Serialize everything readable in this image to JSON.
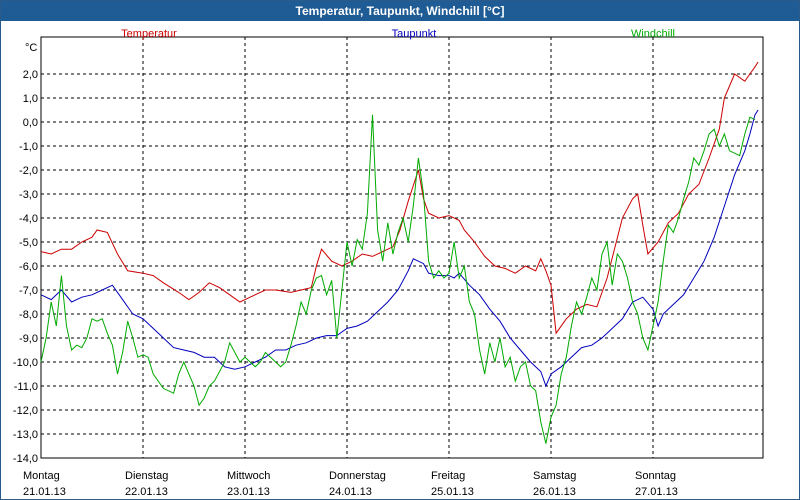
{
  "window": {
    "title": "Temperatur, Taupunkt, Windchill [°C]"
  },
  "chart_data": {
    "type": "line",
    "title": "Temperatur, Taupunkt, Windchill [°C]",
    "ylabel": "°C",
    "ylim": [
      -14,
      3
    ],
    "yticks": [
      "2,0",
      "1,0",
      "0,0",
      "-1,0",
      "-2,0",
      "-3,0",
      "-4,0",
      "-5,0",
      "-6,0",
      "-7,0",
      "-8,0",
      "-9,0",
      "-10,0",
      "-11,0",
      "-12,0",
      "-13,0",
      "-14,0"
    ],
    "ytick_values": [
      2,
      1,
      0,
      -1,
      -2,
      -3,
      -4,
      -5,
      -6,
      -7,
      -8,
      -9,
      -10,
      -11,
      -12,
      -13,
      -14
    ],
    "xlim": [
      0,
      7.03
    ],
    "xticks": [
      {
        "day": "Montag",
        "date": "21.01.13",
        "x": 0
      },
      {
        "day": "Dienstag",
        "date": "22.01.13",
        "x": 1
      },
      {
        "day": "Mittwoch",
        "date": "23.01.13",
        "x": 2
      },
      {
        "day": "Donnerstag",
        "date": "24.01.13",
        "x": 3
      },
      {
        "day": "Freitag",
        "date": "25.01.13",
        "x": 4
      },
      {
        "day": "Samstag",
        "date": "26.01.13",
        "x": 5
      },
      {
        "day": "Sonntag",
        "date": "27.01.13",
        "x": 6
      }
    ],
    "x_unit": "days since 21.01.13 00:00",
    "grid": true,
    "legend_position": "top",
    "series": [
      {
        "name": "Temperatur",
        "color": "#cc0000",
        "points": [
          [
            0,
            -5.4
          ],
          [
            0.1,
            -5.5
          ],
          [
            0.2,
            -5.3
          ],
          [
            0.3,
            -5.3
          ],
          [
            0.4,
            -5.0
          ],
          [
            0.5,
            -4.8
          ],
          [
            0.55,
            -4.5
          ],
          [
            0.65,
            -4.6
          ],
          [
            0.75,
            -5.5
          ],
          [
            0.85,
            -6.2
          ],
          [
            1.0,
            -6.3
          ],
          [
            1.1,
            -6.4
          ],
          [
            1.2,
            -6.7
          ],
          [
            1.35,
            -7.1
          ],
          [
            1.45,
            -7.4
          ],
          [
            1.55,
            -7.1
          ],
          [
            1.65,
            -6.7
          ],
          [
            1.75,
            -6.9
          ],
          [
            1.85,
            -7.2
          ],
          [
            1.95,
            -7.5
          ],
          [
            2.05,
            -7.3
          ],
          [
            2.2,
            -7.0
          ],
          [
            2.3,
            -7.0
          ],
          [
            2.45,
            -7.1
          ],
          [
            2.55,
            -7.0
          ],
          [
            2.65,
            -6.9
          ],
          [
            2.7,
            -6.0
          ],
          [
            2.75,
            -5.3
          ],
          [
            2.85,
            -5.8
          ],
          [
            2.95,
            -6.0
          ],
          [
            3.05,
            -5.8
          ],
          [
            3.15,
            -5.5
          ],
          [
            3.25,
            -5.6
          ],
          [
            3.35,
            -5.4
          ],
          [
            3.45,
            -5.2
          ],
          [
            3.52,
            -4.5
          ],
          [
            3.6,
            -3.3
          ],
          [
            3.7,
            -2.0
          ],
          [
            3.75,
            -3.2
          ],
          [
            3.8,
            -3.8
          ],
          [
            3.9,
            -4.0
          ],
          [
            4.0,
            -3.9
          ],
          [
            4.1,
            -4.1
          ],
          [
            4.15,
            -4.5
          ],
          [
            4.25,
            -5.0
          ],
          [
            4.35,
            -5.6
          ],
          [
            4.45,
            -6.0
          ],
          [
            4.55,
            -6.1
          ],
          [
            4.65,
            -6.3
          ],
          [
            4.75,
            -6.0
          ],
          [
            4.85,
            -6.2
          ],
          [
            4.9,
            -5.7
          ],
          [
            4.95,
            -6.2
          ],
          [
            5.0,
            -6.8
          ],
          [
            5.05,
            -8.8
          ],
          [
            5.15,
            -8.2
          ],
          [
            5.25,
            -7.8
          ],
          [
            5.35,
            -7.6
          ],
          [
            5.45,
            -7.7
          ],
          [
            5.55,
            -6.5
          ],
          [
            5.7,
            -4.0
          ],
          [
            5.8,
            -3.2
          ],
          [
            5.85,
            -3.0
          ],
          [
            5.9,
            -4.3
          ],
          [
            5.95,
            -5.5
          ],
          [
            6.05,
            -5.0
          ],
          [
            6.15,
            -4.2
          ],
          [
            6.25,
            -3.8
          ],
          [
            6.35,
            -3.0
          ],
          [
            6.45,
            -2.6
          ],
          [
            6.55,
            -1.5
          ],
          [
            6.65,
            -0.3
          ],
          [
            6.7,
            1.0
          ],
          [
            6.75,
            1.5
          ],
          [
            6.8,
            2.0
          ],
          [
            6.9,
            1.7
          ],
          [
            6.95,
            2.0
          ],
          [
            7.0,
            2.3
          ],
          [
            7.03,
            2.5
          ]
        ]
      },
      {
        "name": "Taupunkt",
        "color": "#0000bb",
        "points": [
          [
            0,
            -7.2
          ],
          [
            0.1,
            -7.4
          ],
          [
            0.2,
            -7.0
          ],
          [
            0.3,
            -7.5
          ],
          [
            0.4,
            -7.3
          ],
          [
            0.5,
            -7.2
          ],
          [
            0.6,
            -7.0
          ],
          [
            0.7,
            -6.8
          ],
          [
            0.8,
            -7.4
          ],
          [
            0.9,
            -8.0
          ],
          [
            1.0,
            -8.2
          ],
          [
            1.1,
            -8.6
          ],
          [
            1.2,
            -9.0
          ],
          [
            1.3,
            -9.4
          ],
          [
            1.4,
            -9.5
          ],
          [
            1.5,
            -9.6
          ],
          [
            1.6,
            -9.8
          ],
          [
            1.7,
            -9.8
          ],
          [
            1.8,
            -10.2
          ],
          [
            1.9,
            -10.3
          ],
          [
            2.0,
            -10.2
          ],
          [
            2.1,
            -10.0
          ],
          [
            2.2,
            -9.8
          ],
          [
            2.3,
            -9.5
          ],
          [
            2.4,
            -9.5
          ],
          [
            2.5,
            -9.3
          ],
          [
            2.6,
            -9.2
          ],
          [
            2.7,
            -9.0
          ],
          [
            2.8,
            -8.9
          ],
          [
            2.9,
            -8.9
          ],
          [
            3.0,
            -8.6
          ],
          [
            3.1,
            -8.5
          ],
          [
            3.2,
            -8.3
          ],
          [
            3.3,
            -7.9
          ],
          [
            3.4,
            -7.5
          ],
          [
            3.5,
            -7.0
          ],
          [
            3.6,
            -6.2
          ],
          [
            3.65,
            -5.7
          ],
          [
            3.75,
            -5.9
          ],
          [
            3.8,
            -6.3
          ],
          [
            3.9,
            -6.4
          ],
          [
            4.0,
            -6.4
          ],
          [
            4.05,
            -6.5
          ],
          [
            4.1,
            -6.3
          ],
          [
            4.2,
            -6.8
          ],
          [
            4.3,
            -7.2
          ],
          [
            4.4,
            -7.8
          ],
          [
            4.5,
            -8.3
          ],
          [
            4.6,
            -9.0
          ],
          [
            4.7,
            -9.5
          ],
          [
            4.8,
            -10.0
          ],
          [
            4.9,
            -10.4
          ],
          [
            4.95,
            -11.0
          ],
          [
            5.0,
            -10.5
          ],
          [
            5.1,
            -10.2
          ],
          [
            5.2,
            -9.8
          ],
          [
            5.3,
            -9.4
          ],
          [
            5.4,
            -9.3
          ],
          [
            5.5,
            -9.0
          ],
          [
            5.6,
            -8.6
          ],
          [
            5.7,
            -8.2
          ],
          [
            5.8,
            -7.5
          ],
          [
            5.9,
            -7.3
          ],
          [
            6.0,
            -7.8
          ],
          [
            6.05,
            -8.5
          ],
          [
            6.1,
            -8.0
          ],
          [
            6.2,
            -7.6
          ],
          [
            6.3,
            -7.2
          ],
          [
            6.4,
            -6.5
          ],
          [
            6.5,
            -5.8
          ],
          [
            6.6,
            -4.8
          ],
          [
            6.7,
            -3.5
          ],
          [
            6.8,
            -2.2
          ],
          [
            6.9,
            -1.2
          ],
          [
            6.95,
            -0.5
          ],
          [
            7.0,
            0.3
          ],
          [
            7.03,
            0.5
          ]
        ]
      },
      {
        "name": "Windchill",
        "color": "#00aa00",
        "points": [
          [
            0,
            -10.0
          ],
          [
            0.05,
            -9.0
          ],
          [
            0.1,
            -7.5
          ],
          [
            0.15,
            -8.5
          ],
          [
            0.2,
            -6.4
          ],
          [
            0.25,
            -8.5
          ],
          [
            0.3,
            -9.5
          ],
          [
            0.35,
            -9.3
          ],
          [
            0.4,
            -9.4
          ],
          [
            0.45,
            -9.0
          ],
          [
            0.5,
            -8.2
          ],
          [
            0.55,
            -8.3
          ],
          [
            0.6,
            -8.2
          ],
          [
            0.65,
            -8.8
          ],
          [
            0.7,
            -9.3
          ],
          [
            0.75,
            -10.5
          ],
          [
            0.8,
            -9.6
          ],
          [
            0.85,
            -8.3
          ],
          [
            0.9,
            -9.0
          ],
          [
            0.95,
            -9.8
          ],
          [
            1.0,
            -9.7
          ],
          [
            1.05,
            -9.8
          ],
          [
            1.1,
            -10.5
          ],
          [
            1.2,
            -11.1
          ],
          [
            1.3,
            -11.3
          ],
          [
            1.35,
            -10.5
          ],
          [
            1.4,
            -10.0
          ],
          [
            1.5,
            -11.0
          ],
          [
            1.55,
            -11.8
          ],
          [
            1.6,
            -11.5
          ],
          [
            1.65,
            -11.0
          ],
          [
            1.7,
            -10.8
          ],
          [
            1.8,
            -10.0
          ],
          [
            1.85,
            -9.2
          ],
          [
            1.9,
            -9.6
          ],
          [
            1.95,
            -10.0
          ],
          [
            2.0,
            -9.8
          ],
          [
            2.05,
            -10.0
          ],
          [
            2.1,
            -10.2
          ],
          [
            2.15,
            -10.0
          ],
          [
            2.2,
            -9.6
          ],
          [
            2.25,
            -9.8
          ],
          [
            2.3,
            -10.0
          ],
          [
            2.35,
            -10.2
          ],
          [
            2.4,
            -10.0
          ],
          [
            2.45,
            -9.3
          ],
          [
            2.5,
            -8.5
          ],
          [
            2.55,
            -7.5
          ],
          [
            2.6,
            -8.0
          ],
          [
            2.65,
            -7.0
          ],
          [
            2.7,
            -6.5
          ],
          [
            2.75,
            -6.4
          ],
          [
            2.8,
            -7.2
          ],
          [
            2.85,
            -6.6
          ],
          [
            2.9,
            -9.0
          ],
          [
            2.95,
            -7.0
          ],
          [
            3.0,
            -5.0
          ],
          [
            3.05,
            -6.0
          ],
          [
            3.1,
            -4.9
          ],
          [
            3.15,
            -5.3
          ],
          [
            3.2,
            -3.8
          ],
          [
            3.25,
            0.3
          ],
          [
            3.3,
            -4.5
          ],
          [
            3.35,
            -5.8
          ],
          [
            3.4,
            -4.2
          ],
          [
            3.45,
            -5.5
          ],
          [
            3.5,
            -4.6
          ],
          [
            3.55,
            -4.0
          ],
          [
            3.6,
            -5.0
          ],
          [
            3.65,
            -3.5
          ],
          [
            3.7,
            -1.5
          ],
          [
            3.75,
            -3.0
          ],
          [
            3.8,
            -5.8
          ],
          [
            3.85,
            -6.5
          ],
          [
            3.9,
            -6.2
          ],
          [
            3.95,
            -6.5
          ],
          [
            4.0,
            -6.3
          ],
          [
            4.05,
            -5.0
          ],
          [
            4.1,
            -6.5
          ],
          [
            4.15,
            -6.0
          ],
          [
            4.2,
            -7.5
          ],
          [
            4.25,
            -8.0
          ],
          [
            4.3,
            -9.5
          ],
          [
            4.35,
            -10.5
          ],
          [
            4.4,
            -9.2
          ],
          [
            4.45,
            -10.0
          ],
          [
            4.5,
            -9.0
          ],
          [
            4.55,
            -10.2
          ],
          [
            4.6,
            -9.8
          ],
          [
            4.65,
            -10.8
          ],
          [
            4.7,
            -10.2
          ],
          [
            4.75,
            -10.0
          ],
          [
            4.8,
            -11.0
          ],
          [
            4.85,
            -11.2
          ],
          [
            4.9,
            -12.5
          ],
          [
            4.95,
            -13.4
          ],
          [
            5.0,
            -12.3
          ],
          [
            5.05,
            -11.8
          ],
          [
            5.1,
            -10.5
          ],
          [
            5.15,
            -9.8
          ],
          [
            5.2,
            -8.5
          ],
          [
            5.25,
            -7.5
          ],
          [
            5.3,
            -8.0
          ],
          [
            5.35,
            -7.3
          ],
          [
            5.4,
            -6.5
          ],
          [
            5.45,
            -7.0
          ],
          [
            5.5,
            -5.5
          ],
          [
            5.55,
            -5.0
          ],
          [
            5.6,
            -6.8
          ],
          [
            5.65,
            -5.5
          ],
          [
            5.7,
            -5.8
          ],
          [
            5.75,
            -6.5
          ],
          [
            5.8,
            -7.5
          ],
          [
            5.85,
            -8.0
          ],
          [
            5.9,
            -9.0
          ],
          [
            5.95,
            -9.5
          ],
          [
            6.0,
            -8.5
          ],
          [
            6.05,
            -7.5
          ],
          [
            6.1,
            -5.8
          ],
          [
            6.15,
            -4.3
          ],
          [
            6.2,
            -4.6
          ],
          [
            6.25,
            -4.0
          ],
          [
            6.3,
            -3.2
          ],
          [
            6.35,
            -2.5
          ],
          [
            6.4,
            -1.5
          ],
          [
            6.45,
            -1.8
          ],
          [
            6.5,
            -1.2
          ],
          [
            6.55,
            -0.5
          ],
          [
            6.6,
            -0.3
          ],
          [
            6.65,
            -1.0
          ],
          [
            6.7,
            -0.5
          ],
          [
            6.75,
            -1.2
          ],
          [
            6.8,
            -1.3
          ],
          [
            6.85,
            -1.4
          ],
          [
            6.9,
            -0.5
          ],
          [
            6.95,
            0.2
          ],
          [
            7.0,
            0.1
          ]
        ]
      }
    ]
  }
}
